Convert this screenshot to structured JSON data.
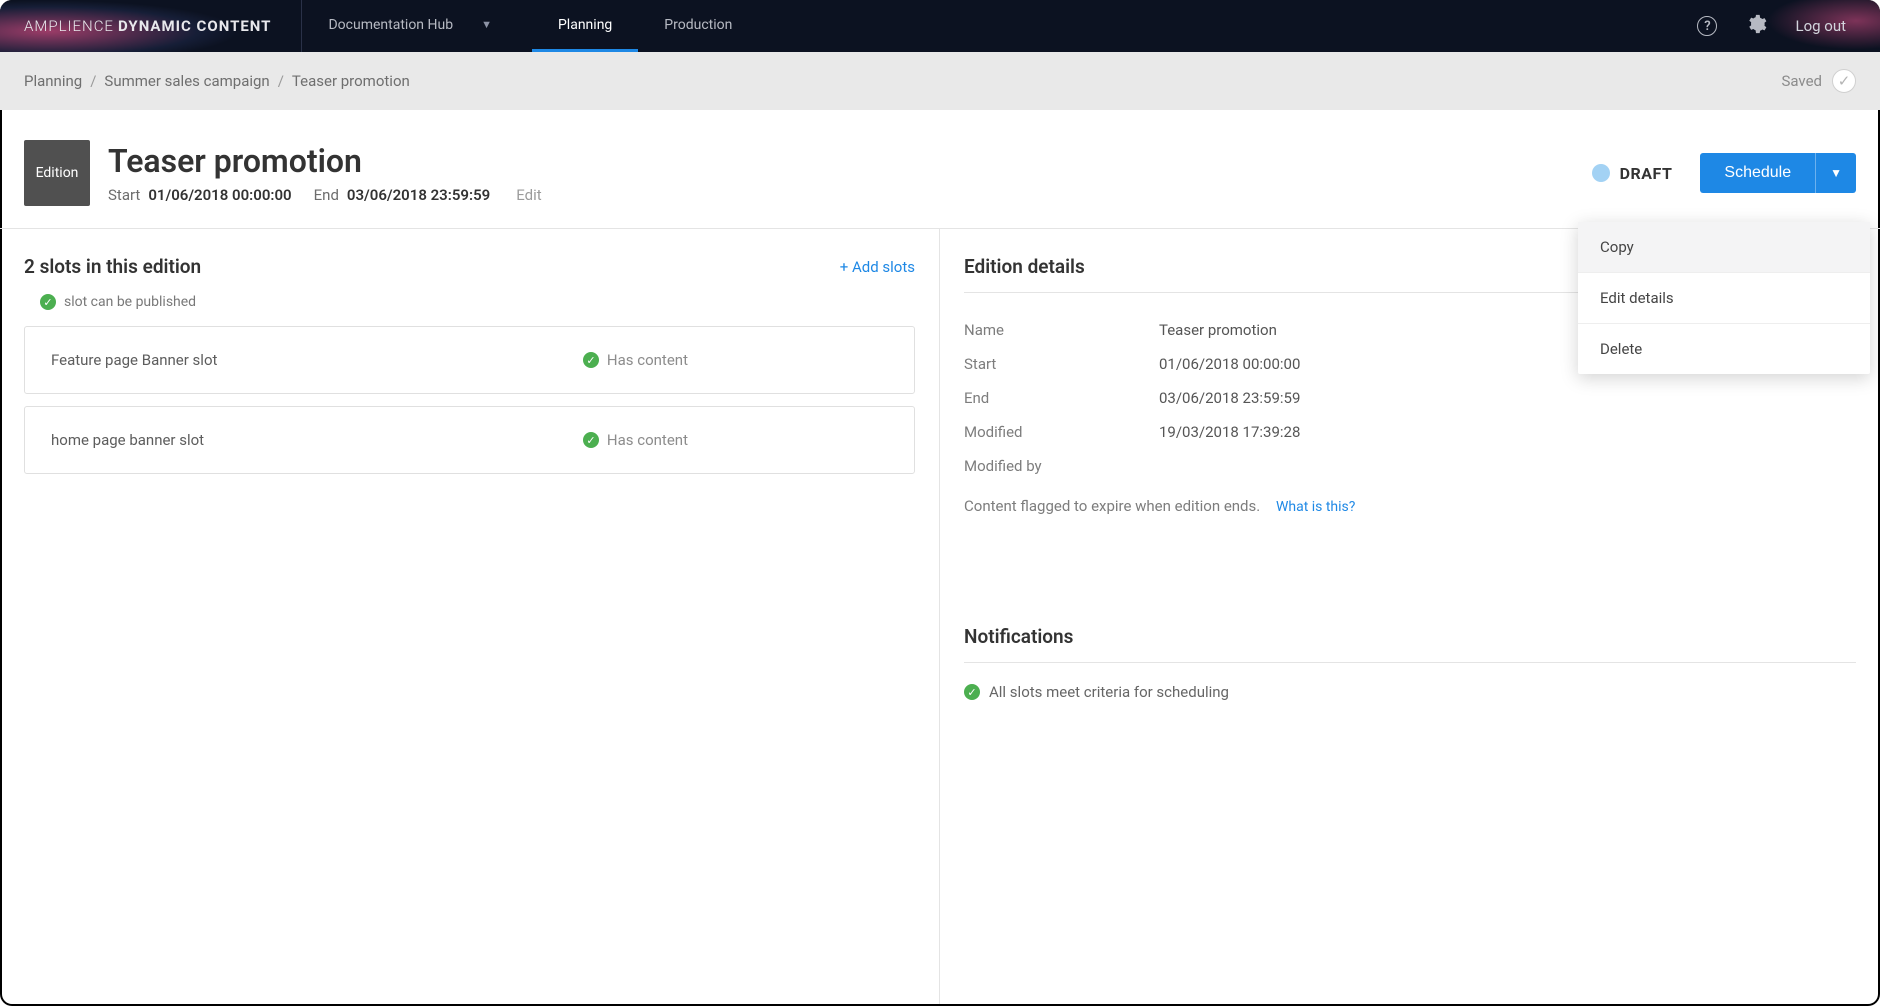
{
  "brand": {
    "thin": "AMPLIENCE",
    "bold": "DYNAMIC CONTENT"
  },
  "nav": {
    "doc_hub": "Documentation Hub",
    "planning": "Planning",
    "production": "Production",
    "logout": "Log out"
  },
  "breadcrumb": {
    "items": [
      "Planning",
      "Summer sales campaign",
      "Teaser promotion"
    ],
    "saved": "Saved"
  },
  "header": {
    "chip": "Edition",
    "title": "Teaser promotion",
    "start_label": "Start",
    "start_value": "01/06/2018 00:00:00",
    "end_label": "End",
    "end_value": "03/06/2018 23:59:59",
    "edit": "Edit",
    "status": "DRAFT",
    "schedule": "Schedule"
  },
  "dropdown": {
    "copy": "Copy",
    "edit_details": "Edit details",
    "delete": "Delete"
  },
  "slots": {
    "heading": "2 slots in this edition",
    "add": "+ Add slots",
    "legend": "slot can be published",
    "has_content": "Has content",
    "items": [
      {
        "name": "Feature page Banner slot"
      },
      {
        "name": "home page banner slot"
      }
    ]
  },
  "details": {
    "title": "Edition details",
    "rows": {
      "name_k": "Name",
      "name_v": "Teaser promotion",
      "start_k": "Start",
      "start_v": "01/06/2018 00:00:00",
      "end_k": "End",
      "end_v": "03/06/2018 23:59:59",
      "modified_k": "Modified",
      "modified_v": "19/03/2018 17:39:28",
      "modifiedby_k": "Modified by",
      "modifiedby_v": ""
    },
    "expire": "Content flagged to expire when edition ends.",
    "whatis": "What is this?"
  },
  "notifications": {
    "title": "Notifications",
    "line": "All slots meet criteria for scheduling"
  }
}
